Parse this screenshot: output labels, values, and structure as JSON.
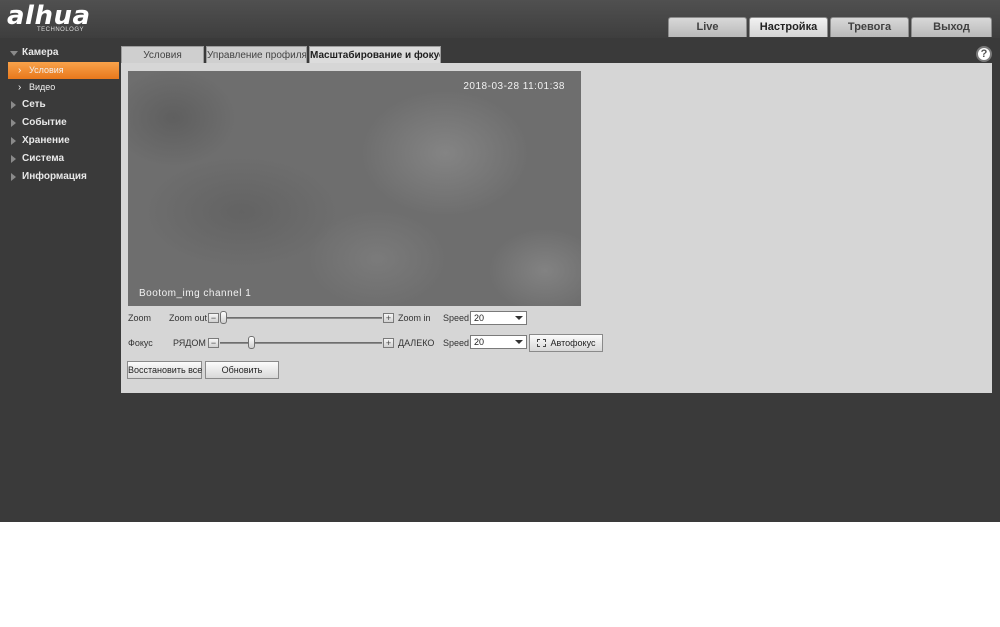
{
  "header": {
    "logo_text": "alhua",
    "logo_subtext": "TECHNOLOGY",
    "nav": [
      "Live",
      "Настройка",
      "Тревога",
      "Выход"
    ],
    "active_nav": "Настройка"
  },
  "help_symbol": "?",
  "sidebar": {
    "items": [
      {
        "label": "Камера",
        "expanded": true,
        "children": [
          {
            "label": "Условия",
            "active": true
          },
          {
            "label": "Видео",
            "active": false
          }
        ]
      },
      {
        "label": "Сеть"
      },
      {
        "label": "Событие"
      },
      {
        "label": "Хранение"
      },
      {
        "label": "Система"
      },
      {
        "label": "Информация"
      }
    ]
  },
  "tabs": [
    "Условия",
    "Управление профиля",
    "Масштабирование и фокус"
  ],
  "active_tab": "Масштабирование и фокус",
  "video": {
    "timestamp": "2018-03-28 11:01:38",
    "channel_label": "Bootom_img channel 1"
  },
  "zoom": {
    "label": "Zoom",
    "min_label": "Zoom out",
    "max_label": "Zoom in",
    "position": 0.0,
    "speed_label": "Speed",
    "speed_value": "20"
  },
  "focus": {
    "label": "Фокус",
    "min_label": "РЯДОМ",
    "max_label": "ДАЛЕКО",
    "position": 0.18,
    "speed_label": "Speed",
    "speed_value": "20",
    "autofocus_label": "Автофокус"
  },
  "buttons": {
    "restore_all": "Восстановить все",
    "refresh": "Обновить"
  },
  "colors": {
    "accent_orange": "#f08a2c",
    "background_dark": "#3a3a3a",
    "panel_gray": "#d6d6d6"
  }
}
